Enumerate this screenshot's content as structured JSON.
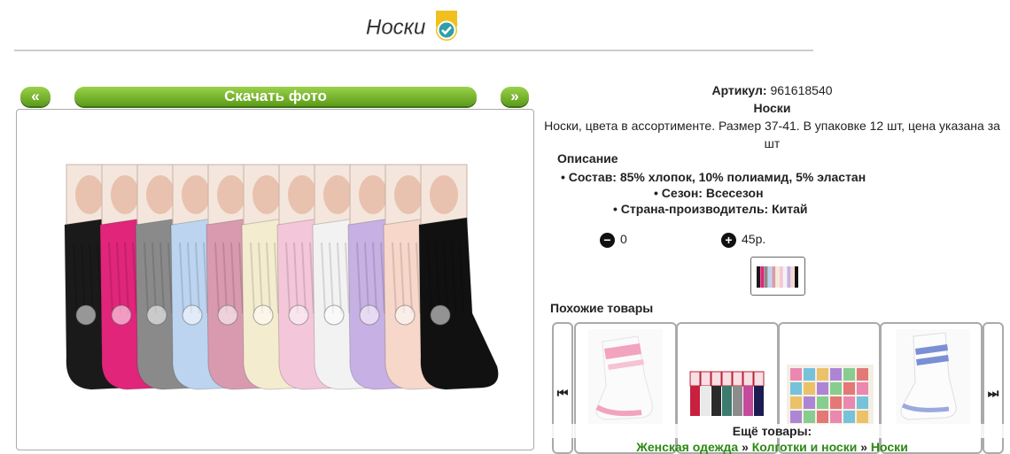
{
  "page": {
    "title": "Носки"
  },
  "photo_nav": {
    "prev_label": "«",
    "download_label": "Скачать фото",
    "next_label": "»"
  },
  "product": {
    "article_label": "Артикул:",
    "article_value": "961618540",
    "name": "Носки",
    "summary": "Носки, цвета в ассортименте. Размер 37-41. В упаковке 12 шт, цена указана за шт",
    "description_title": "Описание",
    "specs": [
      "Состав: 85% хлопок, 10% полиамид, 5% эластан",
      "Сезон: Всесезон",
      "Страна-производитель: Китай"
    ],
    "minus_symbol": "−",
    "plus_symbol": "+",
    "quantity": "0",
    "price": "45р."
  },
  "similar": {
    "title": "Похожие товары",
    "prev_icon": "⏮",
    "next_icon": "⏭"
  },
  "more_goods": {
    "title": "Ещё товары:",
    "crumbs": [
      "Женская одежда",
      "Колготки и носки",
      "Носки"
    ],
    "separator": "»"
  },
  "colors": {
    "accent_green": "#5b9b1a",
    "link_green": "#2a8a12"
  },
  "sock_colors": [
    "#1a1a1a",
    "#e0257a",
    "#8a8a8a",
    "#bcd4ef",
    "#d99ab0",
    "#f3eccf",
    "#f4c6d9",
    "#f2f2f2",
    "#c7b0e3",
    "#f6d7c9",
    "#111111"
  ]
}
